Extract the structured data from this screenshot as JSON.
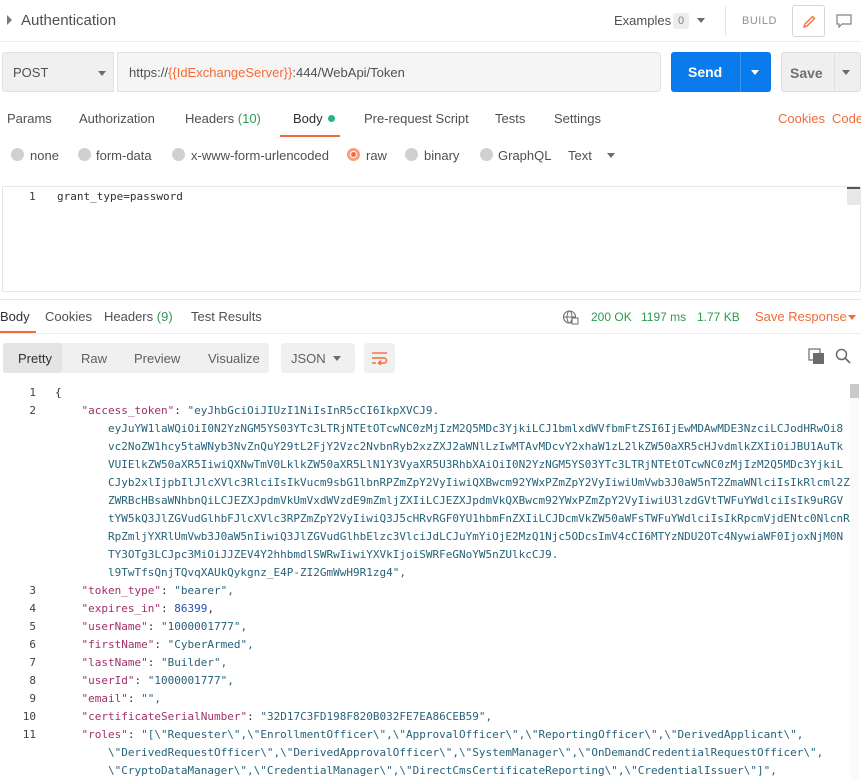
{
  "header": {
    "title": "Authentication",
    "examples_label": "Examples",
    "examples_count": "0",
    "build_label": "BUILD"
  },
  "request": {
    "method": "POST",
    "url_prefix": "https://",
    "url_var": "{{IdExchangeServer}}",
    "url_suffix": ":444/WebApi/Token",
    "send_label": "Send",
    "save_label": "Save"
  },
  "request_tabs": {
    "params": "Params",
    "authorization": "Authorization",
    "headers": "Headers",
    "headers_count": "(10)",
    "body": "Body",
    "pre_request": "Pre-request Script",
    "tests": "Tests",
    "settings": "Settings",
    "cookies": "Cookies",
    "code": "Code"
  },
  "body_types": {
    "none": "none",
    "form_data": "form-data",
    "urlencoded": "x-www-form-urlencoded",
    "raw": "raw",
    "binary": "binary",
    "graphql": "GraphQL",
    "selected_format": "Text"
  },
  "editor": {
    "line_number": "1",
    "content": "grant_type=password"
  },
  "response_tabs": {
    "body": "Body",
    "cookies": "Cookies",
    "headers": "Headers",
    "headers_count": "(9)",
    "test_results": "Test Results"
  },
  "response_status": {
    "status": "200 OK",
    "time": "1197 ms",
    "size": "1.77 KB",
    "save_response": "Save Response"
  },
  "view_modes": {
    "pretty": "Pretty",
    "raw": "Raw",
    "preview": "Preview",
    "visualize": "Visualize",
    "format": "JSON"
  },
  "json_response": {
    "line_numbers": [
      "1",
      "2",
      "",
      "",
      "",
      "",
      "",
      "",
      "",
      "",
      "",
      "3",
      "4",
      "5",
      "6",
      "7",
      "8",
      "9",
      "10",
      "11",
      "",
      ""
    ],
    "lines": [
      "{",
      "    \"access_token\": \"eyJhbGciOiJIUzI1NiIsInR5cCI6IkpXVCJ9.",
      "        eyJuYW1laWQiOiI0N2YzNGM5YS03YTc3LTRjNTEtOTcwNC0zMjIzM2Q5MDc3YjkiLCJ1bmlxdWVfbmFtZSI6IjEwMDAwMDE3NzciLCJodHRwOi8",
      "        vc2NoZW1hcy5taWNyb3NvZnQuY29tL2FjY2Vzc2NvbnRyb2xzZXJ2aWNlLzIwMTAvMDcvY2xhaW1zL2lkZW50aXR5cHJvdmlkZXIiOiJBU1AuTk",
      "        VUIElkZW50aXR5IiwiQXNwTmV0LklkZW50aXR5LlN1Y3VyaXR5U3RhbXAiOiI0N2YzNGM5YS03YTc3LTRjNTEtOTcwNC0zMjIzM2Q5MDc3YjkiL",
      "        CJyb2xlIjpbIlJlcXVlc3RlciIsIkVucm9sbG1lbnRPZmZpY2VyIiwiQXBwcm92YWxPZmZpY2VyIiwiUmVwb3J0aW5nT2ZmaWNlciIsIkRlcml2Z",
      "        ZWRBcHBsaWNhbnQiLCJEZXJpdmVkUmVxdWVzdE9mZmljZXIiLCJEZXJpdmVkQXBwcm92YWxPZmZpY2VyIiwiU3lzdGVtTWFuYWdlciIsIk9uRGV",
      "        tYW5kQ3JlZGVudGlhbFJlcXVlc3RPZmZpY2VyIiwiQ3J5cHRvRGF0YU1hbmFnZXIiLCJDcmVkZW50aWFsTWFuYWdlciIsIkRpcmVjdENtc0NlcnR",
      "        RpZmljYXRlUmVwb3J0aW5nIiwiQ3JlZGVudGlhbElzc3VlciJdLCJuYmYiOjE2MzQ1Njc5ODcsImV4cCI6MTYzNDU2OTc4NywiaWF0IjoxNjM0N",
      "        TY3OTg3LCJpc3MiOiJJZEV4Y2hhbmdlSWRwIiwiYXVkIjoiSWRFeGNoYW5nZUlkcCJ9.",
      "        l9TwTfsQnjTQvqXAUkQykgnz_E4P-ZI2GmWwH9R1zg4\",",
      "    \"token_type\": \"bearer\",",
      "    \"expires_in\": 86399,",
      "    \"userName\": \"1000001777\",",
      "    \"firstName\": \"CyberArmed\",",
      "    \"lastName\": \"Builder\",",
      "    \"userId\": \"1000001777\",",
      "    \"email\": \"\",",
      "    \"certificateSerialNumber\": \"32D17C3FD198F820B032FE7EA86CEB59\",",
      "    \"roles\": \"[\\\"Requester\\\",\\\"EnrollmentOfficer\\\",\\\"ApprovalOfficer\\\",\\\"ReportingOfficer\\\",\\\"DerivedApplicant\\\",",
      "        \\\"DerivedRequestOfficer\\\",\\\"DerivedApprovalOfficer\\\",\\\"SystemManager\\\",\\\"OnDemandCredentialRequestOfficer\\\",",
      "        \\\"CryptoDataManager\\\",\\\"CredentialManager\\\",\\\"DirectCmsCertificateReporting\\\",\\\"CredentialIssuer\\\"]\","
    ]
  },
  "colors": {
    "accent": "#f26b3a",
    "send_button": "#097bed",
    "success": "#2f9a4f"
  }
}
